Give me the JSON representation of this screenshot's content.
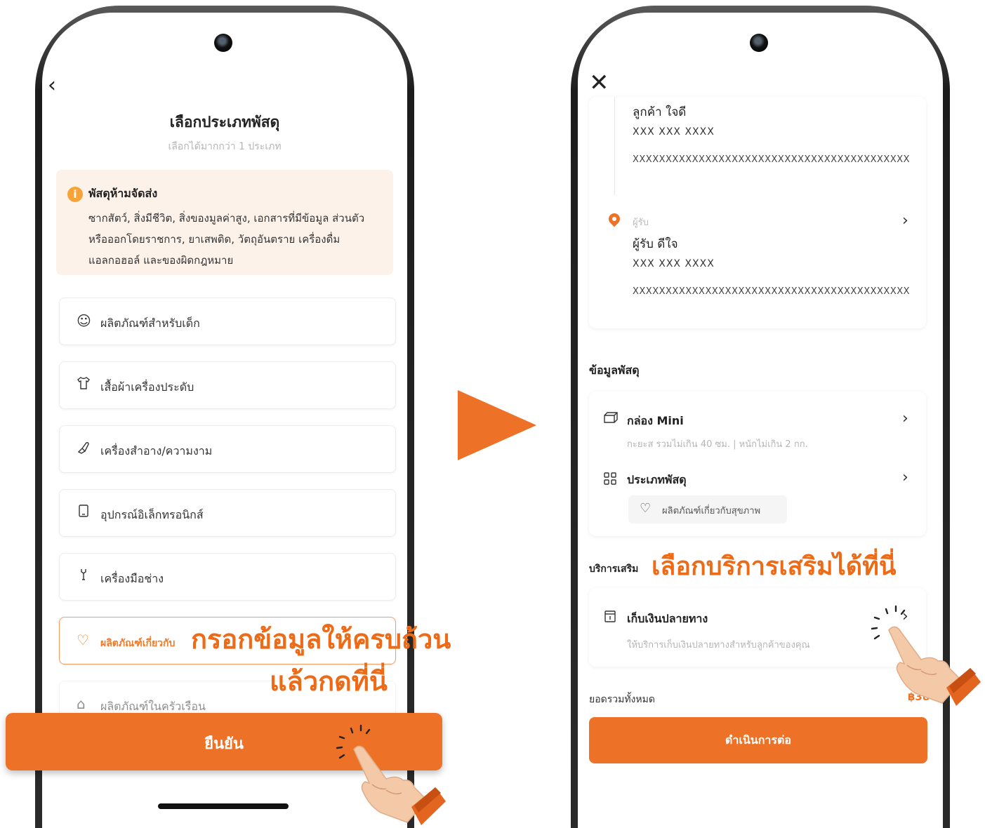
{
  "left_screen": {
    "back_icon": "chevron-left-icon",
    "title": "เลือกประเภทพัสดุ",
    "subtitle": "เลือกได้มากกว่า 1 ประเภท",
    "warning": {
      "icon": "info-icon",
      "title": "พัสดุห้ามจัดส่ง",
      "text": "ซากสัตว์, สิ่งมีชีวิต, สิ่งของมูลค่าสูง, เอกสารที่มีข้อมูล ส่วนตัว หรือออกโดยราชการ, ยาเสพติด, วัตถุอันตราย เครื่องดื่ม แอลกอฮอล์ และของผิดกฎหมาย"
    },
    "categories": [
      {
        "label": "ผลิตภัณฑ์สำหรับเด็ก",
        "icon": "baby-face-icon"
      },
      {
        "label": "เสื้อผ้าเครื่องประดับ",
        "icon": "shirt-icon"
      },
      {
        "label": "เครื่องสำอาง/ความงาม",
        "icon": "lipstick-icon"
      },
      {
        "label": "อุปกรณ์อิเล็กทรอนิกส์",
        "icon": "phone-device-icon"
      },
      {
        "label": "เครื่องมือช่าง",
        "icon": "wrench-icon"
      },
      {
        "label": "ผลิตภัณฑ์เกี่ยวกับ",
        "icon": "heart-icon"
      },
      {
        "label": "ผลิตภัณฑ์ในครัวเรือน",
        "icon": "home-icon"
      }
    ],
    "confirm_label": "ยืนยัน",
    "callout_line1": "กรอกข้อมูลให้ครบถ้วน",
    "callout_line2": "แล้วกดที่นี่"
  },
  "right_screen": {
    "close_icon": "close-icon",
    "sender": {
      "name": "ลูกค้า ใจดี",
      "phone": "XXX XXX XXXX",
      "address": "XXXXXXXXXXXXXXXXXXXXXXXXXXXXXXXXXXXXXXXXXX"
    },
    "receiver": {
      "label": "ผู้รับ",
      "name": "ผู้รับ ดีใจ",
      "phone": "XXX XXX XXXX",
      "address": "XXXXXXXXXXXXXXXXXXXXXXXXXXXXXXXXXXXXXXXXXX"
    },
    "parcel_section_title": "ข้อมูลพัสดุ",
    "box": {
      "title": "กล่อง Mini",
      "subtitle": "กะยะส รวมไม่เกิน 40 ซม. | หนักไม่เกิน 2 กก."
    },
    "parcel_type": {
      "title": "ประเภทพัสดุ",
      "tag": "ผลิตภัณฑ์เกี่ยวกับสุขภาพ"
    },
    "extra_section_title": "บริการเสริม",
    "extra_callout": "เลือกบริการเสริมได้ที่นี่",
    "cod": {
      "title": "เก็บเงินปลายทาง",
      "subtitle": "ให้บริการเก็บเงินปลายทางสำหรับลูกค้าของคุณ"
    },
    "total_label": "ยอดรวมทั้งหมด",
    "total_value": "฿38",
    "continue_label": "ดำเนินการต่อ"
  },
  "colors": {
    "accent": "#ed7228",
    "warning_bg": "#fdf2ea",
    "info_icon": "#f6a43a"
  }
}
